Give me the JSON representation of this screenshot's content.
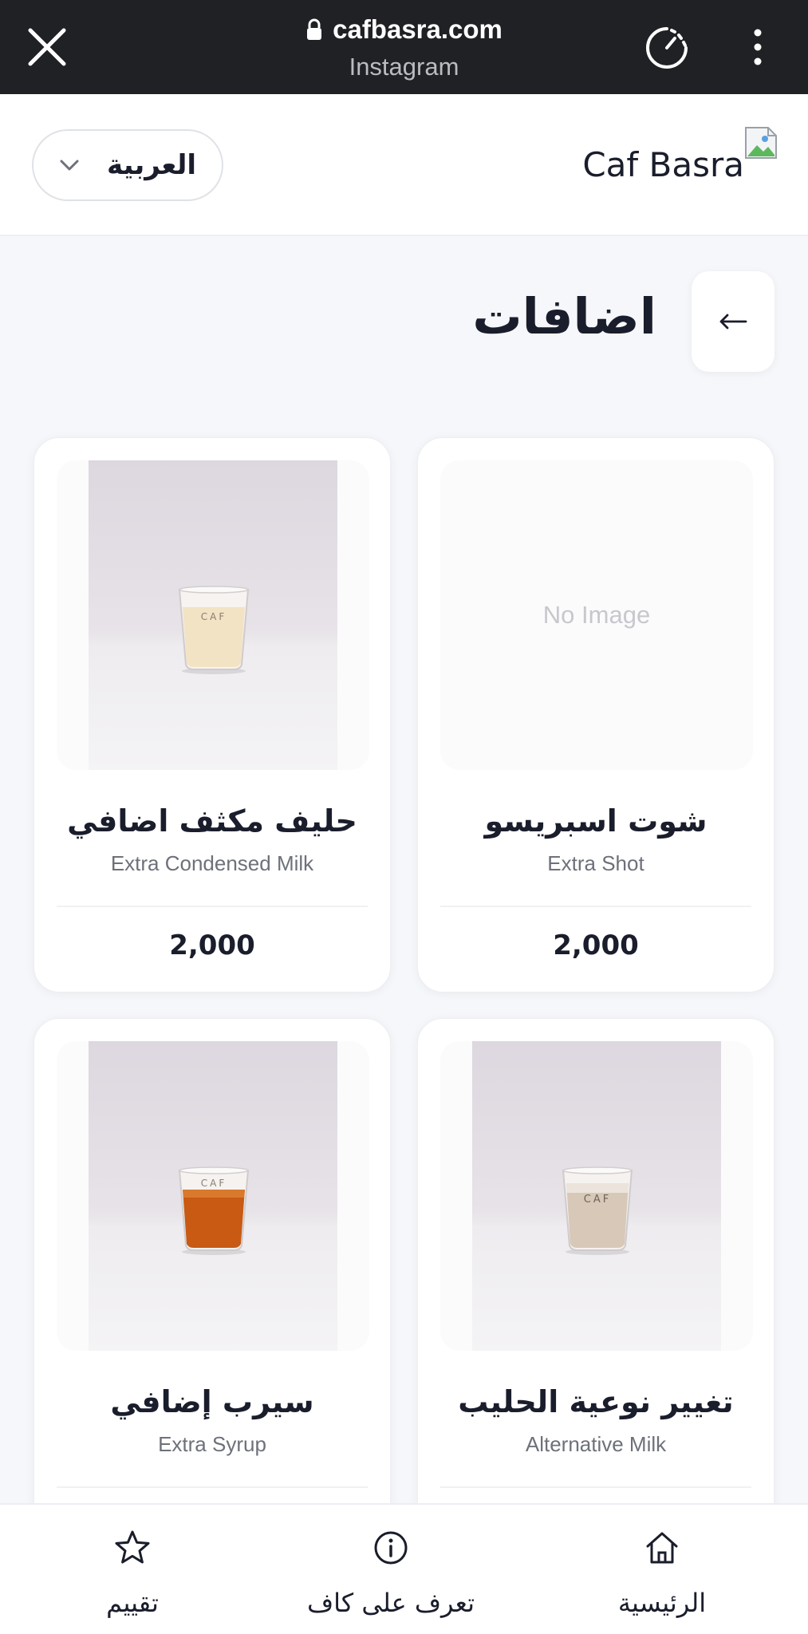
{
  "browser": {
    "url": "cafbasra.com",
    "subtitle": "Instagram"
  },
  "header": {
    "brand_name": "Caf Basra",
    "language": "العربية"
  },
  "page": {
    "title": "اضافات"
  },
  "products": [
    {
      "name": "شوت اسبريسو",
      "subtitle": "Extra Shot",
      "price": "2,000",
      "image": "No Image"
    },
    {
      "name": "حليف مكثف اضافي",
      "subtitle": "Extra Condensed Milk",
      "price": "2,000",
      "image": "photo"
    },
    {
      "name": "تغيير نوعية الحليب",
      "subtitle": "Alternative Milk",
      "price": "",
      "image": "photo"
    },
    {
      "name": "سيرب إضافي",
      "subtitle": "Extra Syrup",
      "price": "",
      "image": "photo"
    }
  ],
  "bottom_nav": {
    "home": "الرئيسية",
    "about": "تعرف على كاف",
    "rate": "تقييم"
  },
  "colors": {
    "browser_bar": "#202124",
    "text": "#1a1d2b",
    "background": "#f6f7fa"
  }
}
